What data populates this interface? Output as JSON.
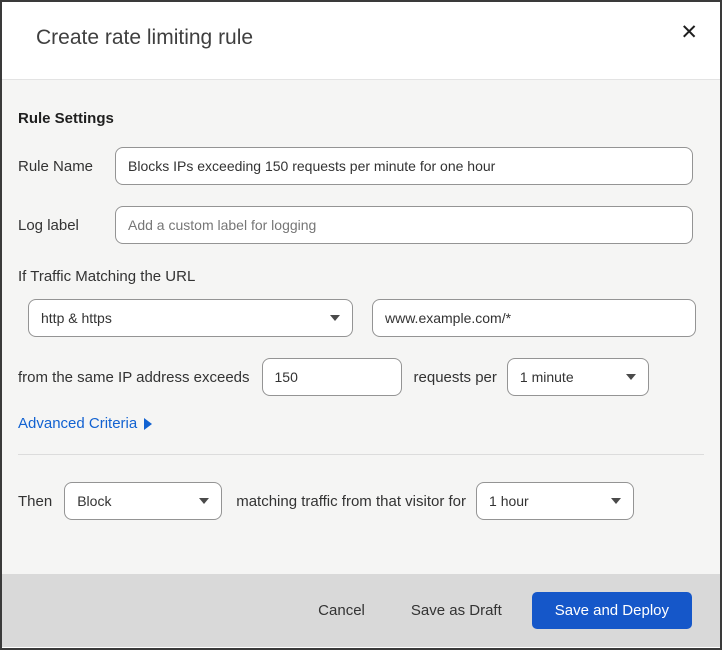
{
  "modal": {
    "title": "Create rate limiting rule",
    "close_icon": "✕"
  },
  "form": {
    "section_heading": "Rule Settings",
    "rule_name": {
      "label": "Rule Name",
      "value": "Blocks IPs exceeding 150 requests per minute for one hour"
    },
    "log_label": {
      "label": "Log label",
      "placeholder": "Add a custom label for logging"
    },
    "traffic_match": {
      "heading": "If Traffic Matching the URL",
      "scheme_selected": "http & https",
      "url_value": "www.example.com/*"
    },
    "threshold": {
      "prefix": "from the same IP address exceeds",
      "requests_value": "150",
      "middle": "requests per",
      "period_selected": "1 minute"
    },
    "advanced_criteria_label": "Advanced Criteria",
    "action": {
      "prefix": "Then",
      "action_selected": "Block",
      "middle": "matching traffic from that visitor for",
      "duration_selected": "1 hour"
    }
  },
  "footer": {
    "cancel_label": "Cancel",
    "save_draft_label": "Save as Draft",
    "save_deploy_label": "Save and Deploy"
  },
  "colors": {
    "primary_button_blue": "#1557c9",
    "link_blue": "#1262d1",
    "body_background": "#f5f5f4",
    "footer_background": "#d9d9d9",
    "top_strip_navy": "#05182b",
    "top_strip_red": "#4a2620"
  }
}
